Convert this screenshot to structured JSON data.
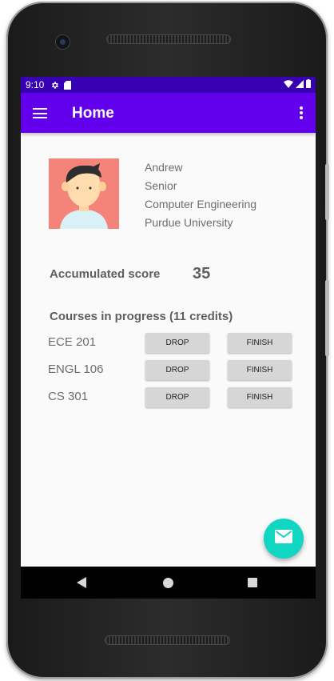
{
  "status_bar": {
    "time": "9:10",
    "icons": [
      "settings-icon",
      "sd-card-icon",
      "wifi-icon",
      "signal-icon",
      "battery-icon"
    ]
  },
  "app_bar": {
    "title": "Home",
    "background": "#6200ee",
    "status_background": "#3700b3"
  },
  "profile": {
    "name": "Andrew",
    "year": "Senior",
    "major": "Computer Engineering",
    "school": "Purdue University"
  },
  "score": {
    "label": "Accumulated score",
    "value": "35"
  },
  "courses": {
    "heading": "Courses in progress (11 credits)",
    "items": [
      {
        "name": "ECE 201",
        "drop_label": "DROP",
        "finish_label": "FINISH"
      },
      {
        "name": "ENGL 106",
        "drop_label": "DROP",
        "finish_label": "FINISH"
      },
      {
        "name": "CS 301",
        "drop_label": "DROP",
        "finish_label": "FINISH"
      }
    ]
  },
  "fab": {
    "icon": "email-icon",
    "color": "#11d6c2"
  }
}
